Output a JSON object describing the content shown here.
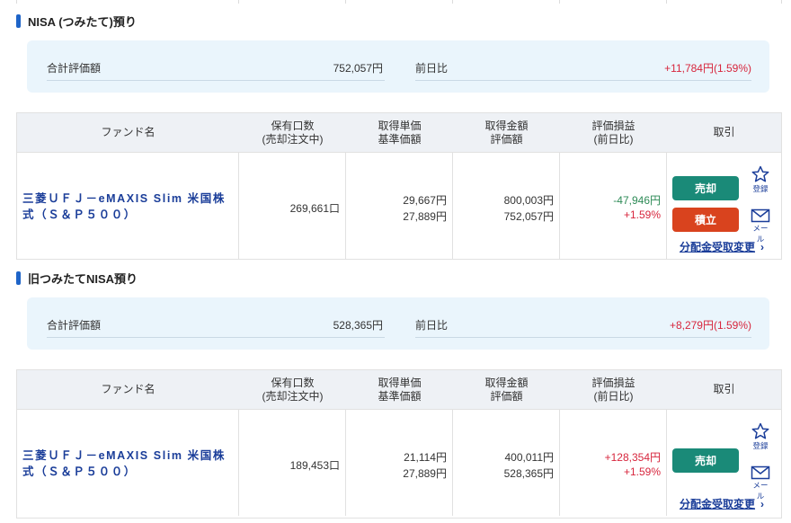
{
  "sections": [
    {
      "title": "NISA (つみたて)預り",
      "summary": {
        "total_label": "合計評価額",
        "total_value": "752,057円",
        "prev_label": "前日比",
        "prev_value": "+11,784円(1.59%)"
      },
      "table": {
        "headers": [
          "ファンド名",
          "保有口数\n(売却注文中)",
          "取得単価\n基準価額",
          "取得金額\n評価額",
          "評価損益\n(前日比)",
          "取引"
        ],
        "row": {
          "fund_name": "三菱ＵＦＪ－eMAXIS Slim 米国株式（Ｓ＆Ｐ５００）",
          "units": "269,661口",
          "unit_cost": "29,667円",
          "base_price": "27,889円",
          "cost_amount": "800,003円",
          "valuation": "752,057円",
          "pl": "-47,946円",
          "pl_change": "+1.59%",
          "sell_label": "売却",
          "buy_label": "積立",
          "register_label": "登録",
          "mail_label": "メール",
          "dist_label": "分配金受取変更"
        }
      }
    },
    {
      "title": "旧つみたてNISA預り",
      "summary": {
        "total_label": "合計評価額",
        "total_value": "528,365円",
        "prev_label": "前日比",
        "prev_value": "+8,279円(1.59%)"
      },
      "table": {
        "headers": [
          "ファンド名",
          "保有口数\n(売却注文中)",
          "取得単価\n基準価額",
          "取得金額\n評価額",
          "評価損益\n(前日比)",
          "取引"
        ],
        "row": {
          "fund_name": "三菱ＵＦＪ－eMAXIS Slim 米国株式（Ｓ＆Ｐ５００）",
          "units": "189,453口",
          "unit_cost": "21,114円",
          "base_price": "27,889円",
          "cost_amount": "400,011円",
          "valuation": "528,365円",
          "pl": "+128,354円",
          "pl_change": "+1.59%",
          "sell_label": "売却",
          "register_label": "登録",
          "mail_label": "メール",
          "dist_label": "分配金受取変更"
        }
      }
    }
  ],
  "colors": {
    "accent": "#1e64c8",
    "link": "#1a3d99",
    "positive": "#d7263d",
    "negative": "#2e8b57",
    "sell": "#1a8a78",
    "buy": "#d9431e",
    "summary_bg": "#eaf5fc"
  },
  "icons": {
    "register": "star-outline-icon",
    "mail": "envelope-icon",
    "chevron": "chevron-right-icon"
  }
}
